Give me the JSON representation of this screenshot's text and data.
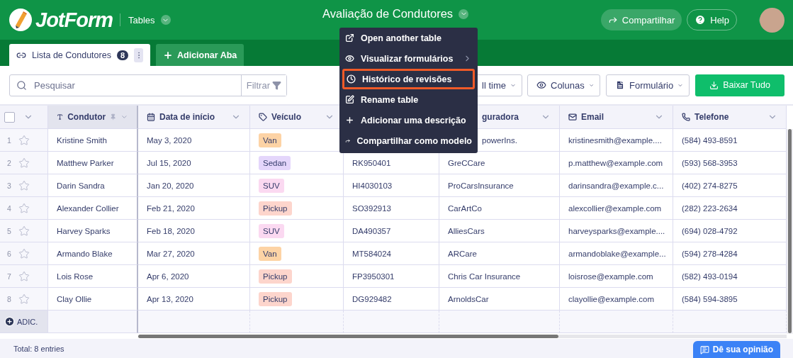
{
  "header": {
    "logo": "JotForm",
    "app_menu": "Tables",
    "title": "Avaliação de Condutores",
    "share_button": "Compartilhar",
    "help_button": "Help"
  },
  "tabs": [
    {
      "label": "Lista de Condutores",
      "count": "8",
      "selected": true
    }
  ],
  "add_tab_button": "Adicionar Aba",
  "table_menu": [
    {
      "label": "Open another table",
      "highlighted": false,
      "submenu": false
    },
    {
      "label": "Visualizar formulários",
      "highlighted": false,
      "submenu": true
    },
    {
      "label": "Histórico de revisões",
      "highlighted": true,
      "submenu": false
    },
    {
      "label": "Rename table",
      "highlighted": false,
      "submenu": false
    },
    {
      "label": "Adicionar uma descrição",
      "highlighted": false,
      "submenu": false
    },
    {
      "label": "Compartilhar como modelo",
      "highlighted": false,
      "submenu": false
    }
  ],
  "toolbar": {
    "search": {
      "placeholder": "Pesquisar"
    },
    "filter_button": "Filtrar",
    "date_filter": "ll time",
    "columns_button": "Colunas",
    "form_button": "Formulário",
    "download_button": "Baixar Tudo"
  },
  "table": {
    "select_all": {
      "checked": false
    },
    "columns": {
      "condutor": "Condutor",
      "data_de_inicio": "Data de início",
      "veiculo": "Veículo",
      "column_5": "guradora",
      "email": "Email",
      "telefone": "Telefone"
    },
    "rows": [
      {
        "number": "1",
        "starred": false,
        "condutor": "Kristine Smith",
        "data_de_inicio": "May 3, 2020",
        "veiculo": {
          "label": "Van",
          "color": "#fdd3a5"
        },
        "column_5": "powerIns.",
        "email": "kristinesmith@example....",
        "telefone": "(584) 493-8591"
      },
      {
        "number": "2",
        "starred": false,
        "condutor": "Matthew Parker",
        "data_de_inicio": "Jul 15, 2020",
        "veiculo": {
          "label": "Sedan",
          "color": "#e4d6fb"
        },
        "column_4": "RK950401",
        "column_5": "GreCCare",
        "email": "p.matthew@example.com",
        "telefone": "(593) 568-3953"
      },
      {
        "number": "3",
        "starred": false,
        "condutor": "Darin Sandra",
        "data_de_inicio": "Jan 20, 2020",
        "veiculo": {
          "label": "SUV",
          "color": "#fbd9f1"
        },
        "column_4": "HI4030103",
        "column_5": "ProCarsInsurance",
        "email": "darinsandra@example.c...",
        "telefone": "(402) 274-8275"
      },
      {
        "number": "4",
        "starred": false,
        "condutor": "Alexander Collier",
        "data_de_inicio": "Feb 21, 2020",
        "veiculo": {
          "label": "Pickup",
          "color": "#fdd5cc"
        },
        "column_4": "SO392913",
        "column_5": "CarArtCo",
        "email": "alexcollier@example.com",
        "telefone": "(282) 223-2634"
      },
      {
        "number": "5",
        "starred": false,
        "condutor": "Harvey Sparks",
        "data_de_inicio": "Feb 18, 2020",
        "veiculo": {
          "label": "SUV",
          "color": "#fbd9f1"
        },
        "column_4": "DA490357",
        "column_5": "AlliesCars",
        "email": "harveysparks@example....",
        "telefone": "(694) 028-4792"
      },
      {
        "number": "6",
        "starred": false,
        "condutor": "Armando Blake",
        "data_de_inicio": "Mar 27, 2020",
        "veiculo": {
          "label": "Van",
          "color": "#fdd3a5"
        },
        "column_4": "MT584024",
        "column_5": "ARCare",
        "email": "armandoblake@example...",
        "telefone": "(594) 278-4284"
      },
      {
        "number": "7",
        "starred": false,
        "condutor": "Lois Rose",
        "data_de_inicio": "Apr 6, 2020",
        "veiculo": {
          "label": "Pickup",
          "color": "#fdd5cc"
        },
        "column_4": "FP3950301",
        "column_5": "Chris Car Insurance",
        "email": "loisrose@example.com",
        "telefone": "(582) 493-0194"
      },
      {
        "number": "8",
        "starred": false,
        "condutor": "Clay Ollie",
        "data_de_inicio": "Apr 13, 2020",
        "veiculo": {
          "label": "Pickup",
          "color": "#fdd5cc"
        },
        "column_4": "DG929482",
        "column_5": "ArnoldsCar",
        "email": "clayollie@example.com",
        "telefone": "(584) 594-3895"
      }
    ],
    "add_row_button": "ADIC."
  },
  "status_bar": {
    "total": "Total: 8 entries",
    "feedback_button": "Dê sua opinião"
  }
}
